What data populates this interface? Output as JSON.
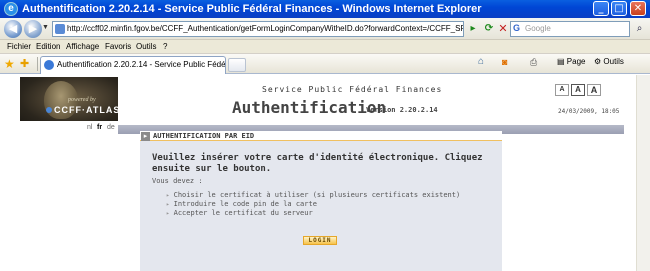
{
  "window": {
    "title": "Authentification 2.20.2.14 - Service Public Fédéral Finances - Windows Internet Explorer",
    "minimize_glyph": "_",
    "maximize_glyph": "□",
    "close_glyph": "✕"
  },
  "address_bar": {
    "url": "http://ccff02.minfin.fgov.be/CCFF_Authentication/getFormLoginCompanyWitheID.do?forwardContext=/CCFF_SP7_2008/eid",
    "search_placeholder": "Google",
    "search_engine_glyph": "G"
  },
  "menu": {
    "items": [
      "Fichier",
      "Edition",
      "Affichage",
      "Favoris",
      "Outils",
      "?"
    ]
  },
  "tabs": {
    "active_tab_label": "Authentification 2.20.2.14 - Service Public Fédéral Fin...",
    "page_menu_label": "Page",
    "tools_menu_label": "Outils"
  },
  "icons": {
    "back": "back-arrow-icon",
    "forward": "forward-arrow-icon",
    "favorites": "favorites-star-icon",
    "add_favorites": "add-favorites-icon",
    "home": "home-icon",
    "feeds": "feeds-icon",
    "print": "print-icon",
    "search": "search-magnifier-icon"
  },
  "header": {
    "powered_by": "powered by",
    "logo_text": "CCFF·ATLAS",
    "service_title": "Service Public Fédéral Finances",
    "page_title": "Authentification",
    "version": "Version 2.20.2.14",
    "datetime": "24/03/2009, 18:05",
    "font_size_buttons": [
      "A",
      "A",
      "A"
    ],
    "languages": [
      "nl",
      "fr",
      "de"
    ]
  },
  "content": {
    "panel_title": "AUTHENTIFICATION PAR EID",
    "instruction": "Veuillez insérer votre carte d'identité électronique. Cliquez ensuite sur le bouton.",
    "must_label": "Vous devez :",
    "steps": [
      "Choisir le certificat à utiliser (si plusieurs certificats existent)",
      "Introduire le code pin de la carte",
      "Accepter le certificat du serveur"
    ],
    "login_label": "LOGIN"
  },
  "colors": {
    "titlebar": "#0a4fd4",
    "panel_background": "#e4e7ee",
    "login_button": "#f6c24a",
    "accent_line": "#f0c060"
  }
}
